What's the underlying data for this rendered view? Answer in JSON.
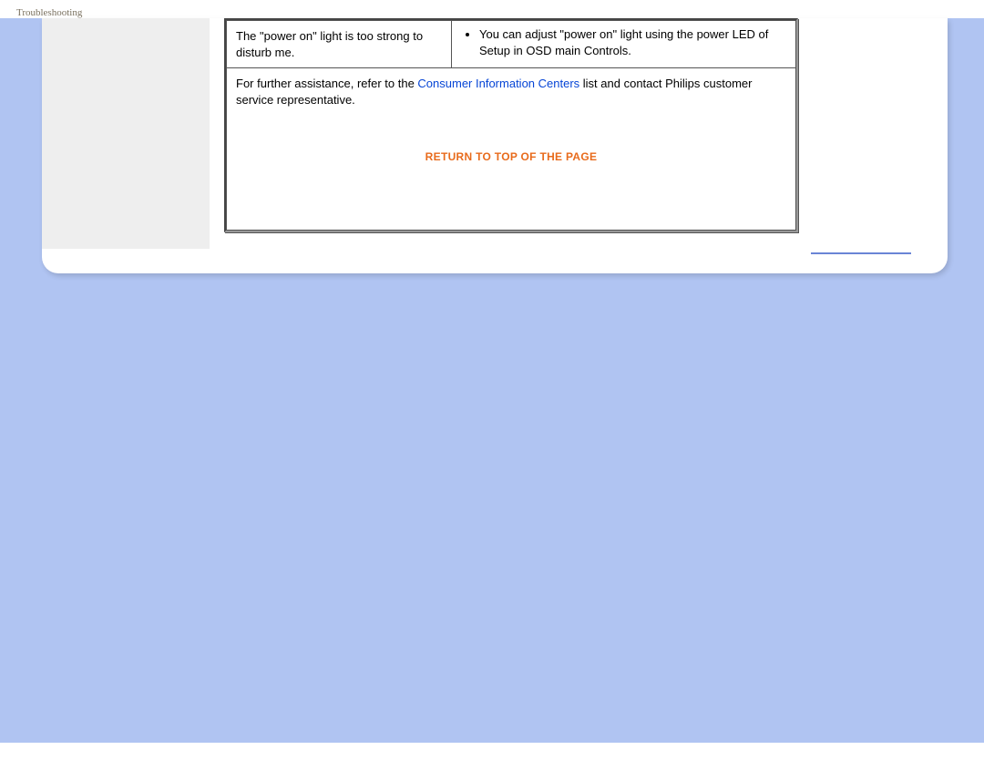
{
  "header": {
    "title": "Troubleshooting"
  },
  "table": {
    "issue": "The \"power on\" light is too strong to disturb me.",
    "solution_bullet": "You can adjust \"power on\" light using the power LED of Setup in OSD main Controls."
  },
  "assist": {
    "prefix": "For further assistance, refer to the ",
    "link": "Consumer Information Centers",
    "suffix": " list and contact Philips customer service representative."
  },
  "return_label": "RETURN TO TOP OF THE PAGE"
}
